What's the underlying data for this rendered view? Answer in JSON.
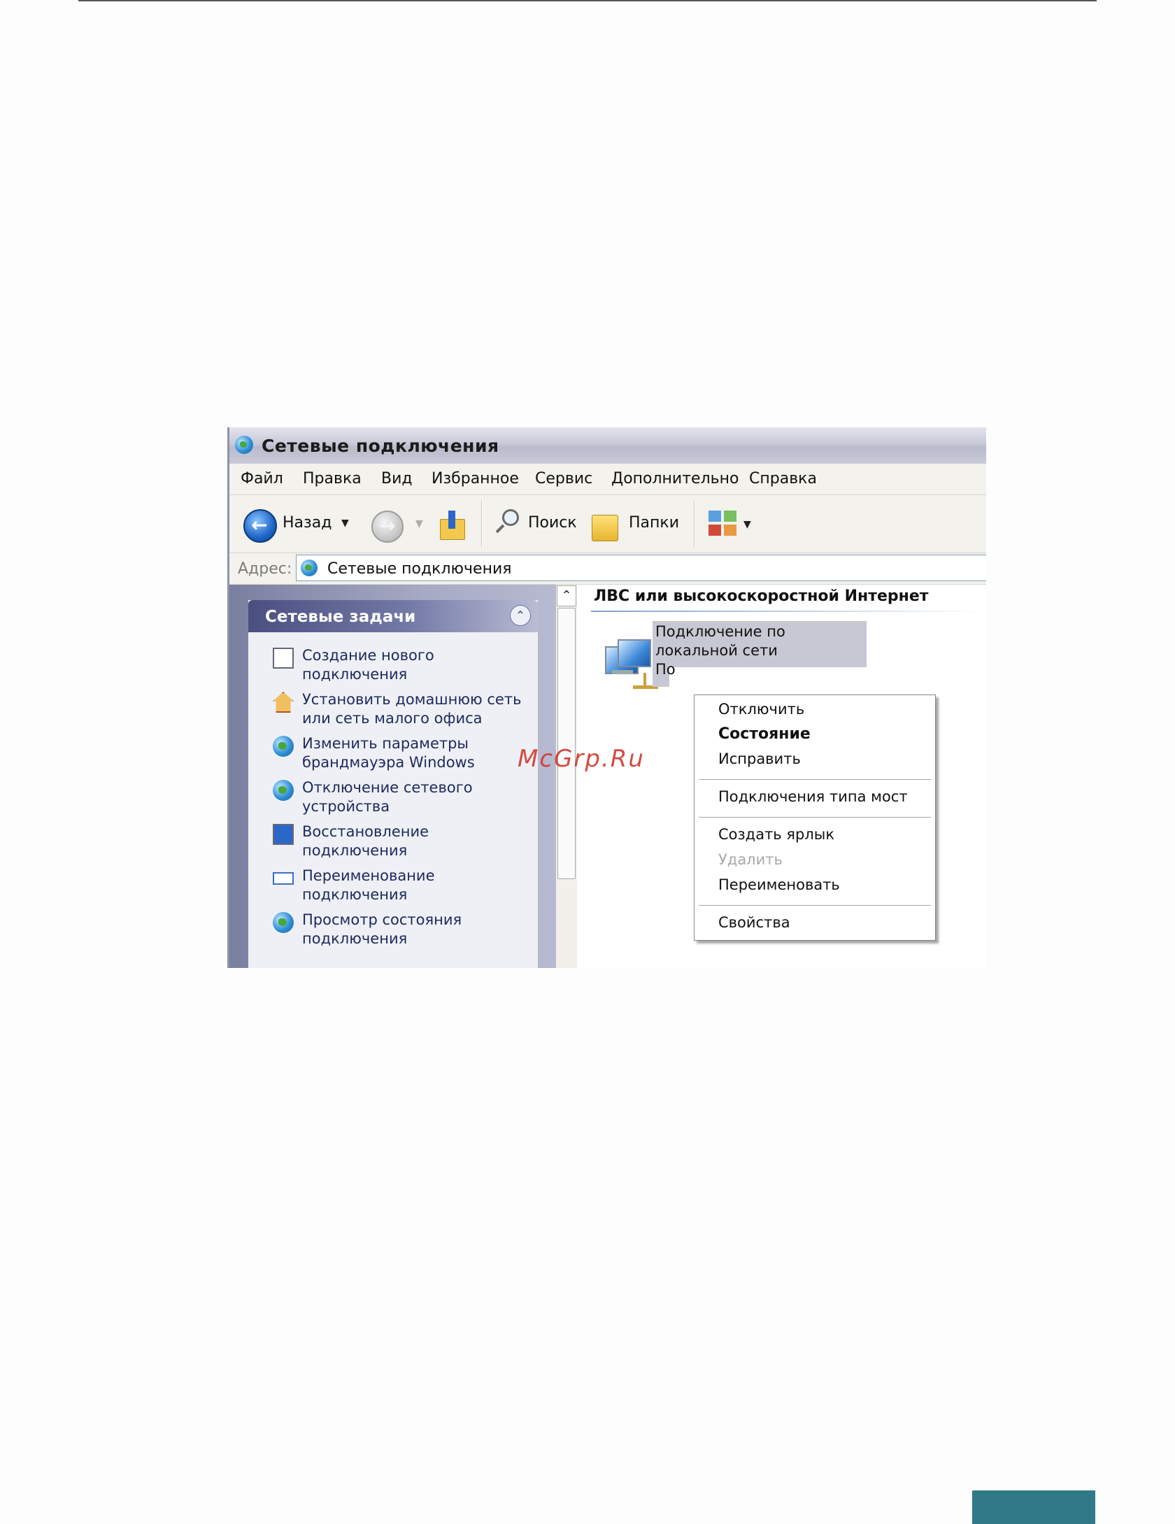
{
  "window": {
    "title": "Сетевые подключения"
  },
  "menu": {
    "items": [
      "Файл",
      "Правка",
      "Вид",
      "Избранное",
      "Сервис",
      "Дополнительно",
      "Справка"
    ]
  },
  "toolbar": {
    "back_label": "Назад",
    "search_label": "Поиск",
    "folders_label": "Папки"
  },
  "address": {
    "label": "Адрес:",
    "value": "Сетевые подключения"
  },
  "tasks": {
    "header": "Сетевые задачи",
    "items": [
      {
        "label": "Создание нового подключения",
        "icon": "new-connection-icon"
      },
      {
        "label": "Установить домашнюю сеть или сеть малого офиса",
        "icon": "home-network-icon"
      },
      {
        "label": "Изменить параметры брандмауэра Windows",
        "icon": "firewall-icon"
      },
      {
        "label": "Отключение сетевого устройства",
        "icon": "disable-device-icon"
      },
      {
        "label": "Восстановление подключения",
        "icon": "repair-connection-icon"
      },
      {
        "label": "Переименование подключения",
        "icon": "rename-icon"
      },
      {
        "label": "Просмотр состояния подключения",
        "icon": "status-icon"
      }
    ]
  },
  "content": {
    "group_title": "ЛВС или высокоскоростной Интернет",
    "connection_name": "Подключение по локальной сети",
    "connection_sub_visible": "По"
  },
  "context_menu": {
    "items": [
      {
        "label": "Отключить",
        "bold": false,
        "disabled": false
      },
      {
        "label": "Состояние",
        "bold": true,
        "disabled": false
      },
      {
        "label": "Исправить",
        "bold": false,
        "disabled": false
      },
      {
        "label": "Подключения типа мост",
        "bold": false,
        "disabled": false
      },
      {
        "label": "Создать ярлык",
        "bold": false,
        "disabled": false
      },
      {
        "label": "Удалить",
        "bold": false,
        "disabled": true
      },
      {
        "label": "Переименовать",
        "bold": false,
        "disabled": false
      },
      {
        "label": "Свойства",
        "bold": false,
        "disabled": false
      }
    ]
  },
  "watermark": "McGrp.Ru",
  "colors": {
    "accent_bar": "#2f7a86",
    "selection": "#c8c8d4",
    "task_text": "#1c2a5c"
  }
}
